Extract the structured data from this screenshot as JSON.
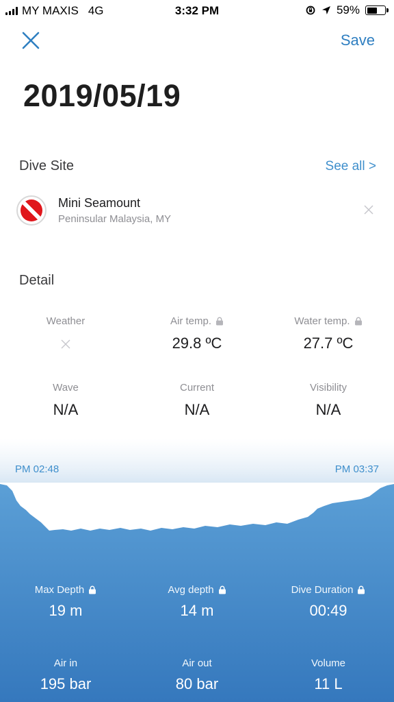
{
  "status_bar": {
    "carrier": "MY MAXIS",
    "network": "4G",
    "time": "3:32 PM",
    "battery_percent": "59%",
    "battery_level": 0.59
  },
  "nav": {
    "close_icon": "close-icon",
    "save_label": "Save"
  },
  "dive": {
    "date": "2019/05/19"
  },
  "dive_site": {
    "section_title": "Dive Site",
    "see_all_label": "See all >",
    "name": "Mini Seamount",
    "region": "Peninsular Malaysia, MY",
    "icon": "dive-flag-icon"
  },
  "detail": {
    "section_title": "Detail",
    "items": [
      {
        "label": "Weather",
        "value": "",
        "locked": false,
        "empty": true
      },
      {
        "label": "Air temp.",
        "value": "29.8 ºC",
        "locked": true
      },
      {
        "label": "Water temp.",
        "value": "27.7 ºC",
        "locked": true
      },
      {
        "label": "Wave",
        "value": "N/A",
        "locked": false
      },
      {
        "label": "Current",
        "value": "N/A",
        "locked": false
      },
      {
        "label": "Visibility",
        "value": "N/A",
        "locked": false
      }
    ]
  },
  "profile": {
    "start_time": "PM 02:48",
    "end_time": "PM 03:37",
    "colors": {
      "top": "#5b9fd6",
      "bottom": "#3578bd"
    }
  },
  "stats": [
    {
      "label": "Max Depth",
      "value": "19  m",
      "locked": true
    },
    {
      "label": "Avg depth",
      "value": "14  m",
      "locked": true
    },
    {
      "label": "Dive Duration",
      "value": "00:49",
      "locked": true
    },
    {
      "label": "Air in",
      "value": "195  bar",
      "locked": false
    },
    {
      "label": "Air out",
      "value": "80  bar",
      "locked": false
    },
    {
      "label": "Volume",
      "value": "11  L",
      "locked": false
    }
  ]
}
